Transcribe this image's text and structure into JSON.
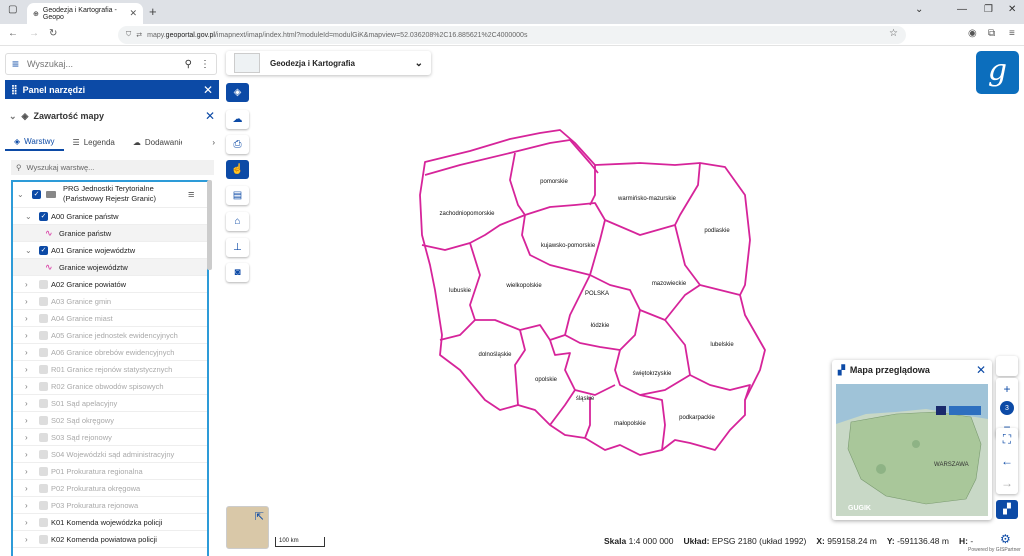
{
  "browser": {
    "tab_title": "Geodezja i Kartografia - Geopo",
    "url_prefix": "mapy.",
    "url_domain": "geoportal.gov.pl",
    "url_rest": "/imapnext/imap/index.html?moduleId=modulGiK&mapview=52.036208%2C16.885621%2C4000000s"
  },
  "search": {
    "placeholder": "Wyszukaj..."
  },
  "tools_panel": {
    "title": "Panel narzędzi"
  },
  "map_content": {
    "title": "Zawartość mapy",
    "tabs": [
      "Warstwy",
      "Legenda",
      "Dodawanie"
    ],
    "layer_search_placeholder": "Wyszukaj warstwę...",
    "group_title_1": "PRG Jednostki Terytorialne",
    "group_title_2": "(Państwowy Rejestr Granic)",
    "layers": [
      {
        "label": "A00 Granice państw",
        "checked": true,
        "enabled": true,
        "expanded": true
      },
      {
        "label": "Granice państw",
        "legend": true
      },
      {
        "label": "A01 Granice województw",
        "checked": true,
        "enabled": true,
        "expanded": true
      },
      {
        "label": "Granice województw",
        "legend": true
      },
      {
        "label": "A02 Granice powiatów",
        "checked": false,
        "enabled": true
      },
      {
        "label": "A03 Granice gmin",
        "checked": false,
        "enabled": false
      },
      {
        "label": "A04 Granice miast",
        "checked": false,
        "enabled": false
      },
      {
        "label": "A05 Granice jednostek ewidencyjnych",
        "checked": false,
        "enabled": false
      },
      {
        "label": "A06 Granice obrebów ewidencyjnych",
        "checked": false,
        "enabled": false
      },
      {
        "label": "R01 Granice rejonów statystycznych",
        "checked": false,
        "enabled": false
      },
      {
        "label": "R02 Granice obwodów spisowych",
        "checked": false,
        "enabled": false
      },
      {
        "label": "S01 Sąd apelacyjny",
        "checked": false,
        "enabled": false
      },
      {
        "label": "S02 Sąd okręgowy",
        "checked": false,
        "enabled": false
      },
      {
        "label": "S03 Sąd rejonowy",
        "checked": false,
        "enabled": false
      },
      {
        "label": "S04 Wojewódzki sąd administracyjny",
        "checked": false,
        "enabled": false
      },
      {
        "label": "P01 Prokuratura regionalna",
        "checked": false,
        "enabled": false
      },
      {
        "label": "P02 Prokuratura okręgowa",
        "checked": false,
        "enabled": false
      },
      {
        "label": "P03 Prokuratura rejonowa",
        "checked": false,
        "enabled": false
      },
      {
        "label": "K01 Komenda wojewódzka policji",
        "checked": false,
        "enabled": true
      },
      {
        "label": "K02 Komenda powiatowa policji",
        "checked": false,
        "enabled": true
      }
    ]
  },
  "map_selector": {
    "label": "Geodezja i Kartografia"
  },
  "map": {
    "border_color": "#d6249a",
    "country_label": "POLSKA",
    "voivodeships": [
      "pomorskie",
      "warmińsko-mazurskie",
      "zachodniopomorskie",
      "kujawsko-pomorskie",
      "podlaskie",
      "lubuskie",
      "wielkopolskie",
      "mazowieckie",
      "łódzkie",
      "dolnośląskie",
      "lubelskie",
      "opolskie",
      "świętokrzyskie",
      "śląskie",
      "małopolskie",
      "podkarpackie"
    ]
  },
  "overview": {
    "title": "Mapa przeglądowa",
    "region_label": "WARSZAWA",
    "provider": "GUGIK"
  },
  "zoom": {
    "level": "3"
  },
  "scale_bar": {
    "label": "100 km"
  },
  "status": {
    "scale_label": "Skala",
    "scale_value": "1:4 000 000",
    "crs_label": "Układ:",
    "crs_value": "EPSG 2180 (układ 1992)",
    "x_label": "X:",
    "x_value": "959158.24 m",
    "y_label": "Y:",
    "y_value": "-591136.48 m",
    "h_label": "H:",
    "h_value": "-"
  },
  "powered_by": "Powered by GISPartner",
  "colors": {
    "accent": "#0c4aa6",
    "border": "#d6249a",
    "highlight": "#2d9bd8"
  }
}
